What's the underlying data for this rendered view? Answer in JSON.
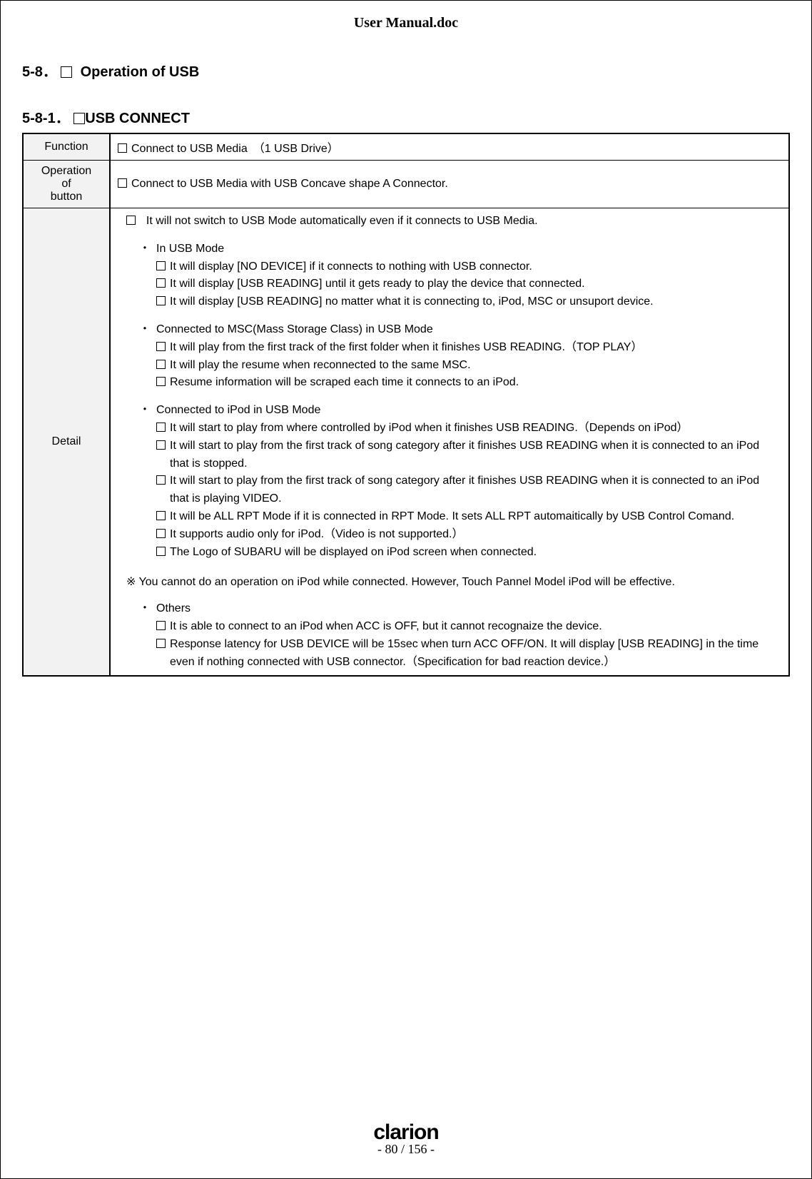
{
  "doc_title": "User Manual.doc",
  "section_number": "5-8．",
  "section_title": "Operation of USB",
  "subsection_number": "5-8-1．",
  "subsection_title": "USB CONNECT",
  "row_function_label": "Function",
  "row_function_text": "Connect to USB Media　（1 USB Drive）",
  "row_operation_label_l1": "Operation",
  "row_operation_label_l2": "of",
  "row_operation_label_l3": "button",
  "row_operation_text": "Connect to USB Media with USB Concave shape A Connector.",
  "row_detail_label": "Detail",
  "detail": {
    "intro": "It will not switch to USB Mode automatically even if it connects to USB Media.",
    "group1_title": "In USB Mode",
    "group1_items": [
      "It will display [NO DEVICE] if it connects to nothing with USB connector.",
      "It will display [USB READING] until it gets ready to play the device that connected.",
      "It will display [USB READING] no matter what it is connecting to, iPod, MSC or unsuport device."
    ],
    "group2_title": "Connected to MSC(Mass Storage Class) in USB Mode",
    "group2_items": [
      "It will play from the first track of the first folder when it finishes USB READING.（TOP PLAY）",
      "It will play the resume when reconnected to the same MSC.",
      "Resume information will be scraped each time it connects to an iPod."
    ],
    "group3_title": "Connected  to iPod in USB Mode",
    "group3_items": [
      "It will start to play from where controlled by iPod when it finishes USB READING.（Depends on iPod）",
      "It will start to play from the first track of song category after it finishes USB READING when it is connected to an iPod that is stopped.",
      "It will start to play from the first track of song category after it finishes USB READING when it is connected to an iPod that is playing VIDEO.",
      "It will be ALL RPT Mode if it is connected in RPT Mode. It sets ALL RPT automaitically by USB Control Comand.",
      "It supports audio only for iPod.（Video is not supported.）",
      "The Logo of SUBARU will be displayed on iPod screen when connected."
    ],
    "note": "※ You cannot do an operation on iPod while connected. However, Touch Pannel Model iPod will be effective.",
    "group4_title": "Others",
    "group4_items": [
      "It is able to connect to an iPod when ACC is OFF, but it cannot recognaize the device.",
      "Response latency for USB DEVICE will be 15sec when turn ACC OFF/ON. It will display [USB READING] in the time even if nothing connected with USB connector.（Specification for bad reaction device.）"
    ]
  },
  "footer_brand": "clarion",
  "footer_page": "- 80 / 156 -"
}
